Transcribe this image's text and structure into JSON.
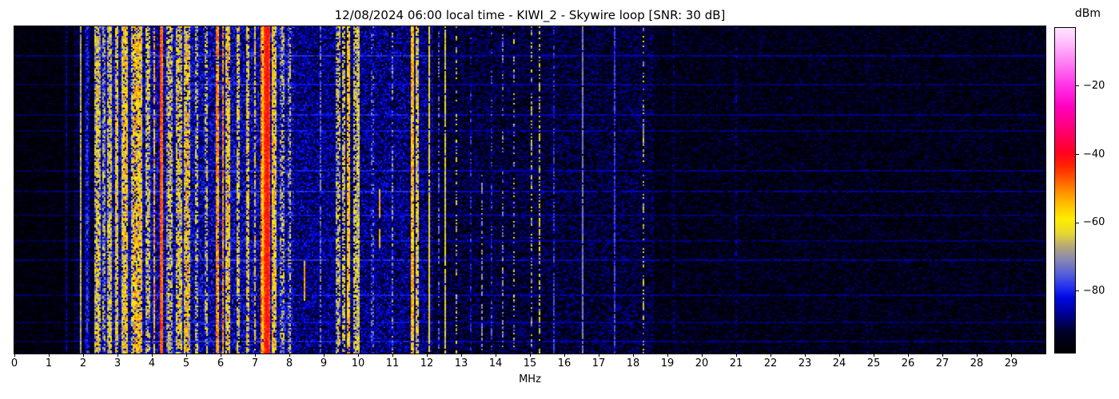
{
  "chart_data": {
    "type": "heatmap",
    "subtype": "radio-spectrum-waterfall",
    "title": "12/08/2024 06:00 local time - KIWI_2 - Skywire loop [SNR: 30 dB]",
    "xlabel": "MHz",
    "x_range": [
      0,
      30
    ],
    "x_ticks": [
      0,
      1,
      2,
      3,
      4,
      5,
      6,
      7,
      8,
      9,
      10,
      11,
      12,
      13,
      14,
      15,
      16,
      17,
      18,
      19,
      20,
      21,
      22,
      23,
      24,
      25,
      26,
      27,
      28,
      29
    ],
    "y_axis": "time (rows, no tick labels shown)",
    "grid": false,
    "legend": "none",
    "colorbar": {
      "label": "dBm",
      "position": "right",
      "ticks": [
        -20,
        -40,
        -60,
        -80
      ],
      "vmin": -98,
      "vmax": -3,
      "colormap": [
        [
          -98,
          "#000000"
        ],
        [
          -92,
          "#000028"
        ],
        [
          -87,
          "#000090"
        ],
        [
          -82,
          "#0008e0"
        ],
        [
          -79,
          "#2030f0"
        ],
        [
          -75,
          "#5560d8"
        ],
        [
          -71,
          "#8585b5"
        ],
        [
          -67,
          "#b5a878"
        ],
        [
          -63,
          "#e8d830"
        ],
        [
          -59,
          "#ffee00"
        ],
        [
          -55,
          "#ffc400"
        ],
        [
          -51,
          "#ff9000"
        ],
        [
          -47,
          "#ff5500"
        ],
        [
          -43,
          "#ff2000"
        ],
        [
          -39,
          "#ff0028"
        ],
        [
          -33,
          "#ff0070"
        ],
        [
          -26,
          "#ff00c0"
        ],
        [
          -20,
          "#ff30e8"
        ],
        [
          -13,
          "#ff80f4"
        ],
        [
          -7,
          "#ffc0fc"
        ],
        [
          -3,
          "#ffe2ff"
        ]
      ]
    },
    "noise_regions": [
      {
        "f0": 0.0,
        "f1": 1.7,
        "base": -96.5,
        "noise": 5.5
      },
      {
        "f0": 1.7,
        "f1": 2.32,
        "base": -93,
        "noise": 6
      },
      {
        "f0": 2.32,
        "f1": 8.15,
        "base": -85.5,
        "noise": 8.5
      },
      {
        "f0": 8.15,
        "f1": 12.2,
        "base": -88,
        "noise": 8
      },
      {
        "f0": 12.2,
        "f1": 18.6,
        "base": -92.5,
        "noise": 7
      },
      {
        "f0": 18.6,
        "f1": 30.01,
        "base": -95,
        "noise": 6
      }
    ],
    "row_streaks": [
      {
        "y": 0.09,
        "b": 7
      },
      {
        "y": 0.175,
        "b": 5
      },
      {
        "y": 0.27,
        "b": 6
      },
      {
        "y": 0.315,
        "b": 5
      },
      {
        "y": 0.44,
        "b": 6
      },
      {
        "y": 0.5,
        "b": 7
      },
      {
        "y": 0.575,
        "b": 5
      },
      {
        "y": 0.655,
        "b": 5
      },
      {
        "y": 0.71,
        "b": 7
      },
      {
        "y": 0.82,
        "b": 6
      },
      {
        "y": 0.9,
        "b": 5
      },
      {
        "y": 0.96,
        "b": 6
      }
    ],
    "signals": [
      {
        "f": 1.5,
        "w": 0.035,
        "level": -84,
        "var": 5,
        "duty": 0.85
      },
      {
        "f": 1.95,
        "w": 0.045,
        "level": -60,
        "var": 5,
        "duty": 0.95
      },
      {
        "f": 2.12,
        "w": 0.14,
        "level": -80,
        "var": 6,
        "duty": 0.9
      },
      {
        "f": 2.42,
        "w": 0.16,
        "level": -60,
        "var": 9,
        "duty": 0.8
      },
      {
        "f": 2.6,
        "w": 0.12,
        "level": -68,
        "var": 9,
        "duty": 0.7
      },
      {
        "f": 2.78,
        "w": 0.16,
        "level": -62,
        "var": 9,
        "duty": 0.8
      },
      {
        "f": 2.98,
        "w": 0.12,
        "level": -59,
        "var": 9,
        "duty": 0.8
      },
      {
        "f": 3.22,
        "w": 0.18,
        "level": -57,
        "var": 9,
        "duty": 0.85
      },
      {
        "f": 3.45,
        "w": 0.12,
        "level": -61,
        "var": 9,
        "duty": 0.75
      },
      {
        "f": 3.5,
        "w": 0.05,
        "level": -52,
        "var": 7,
        "duty": 0.8
      },
      {
        "f": 3.63,
        "w": 0.2,
        "level": -57,
        "var": 10,
        "duty": 0.85
      },
      {
        "f": 3.88,
        "w": 0.16,
        "level": -62,
        "var": 9,
        "duty": 0.7
      },
      {
        "f": 4.07,
        "w": 0.07,
        "level": -53,
        "var": 9,
        "duty": 0.85
      },
      {
        "f": 4.27,
        "w": 0.1,
        "level": -45,
        "var": 5,
        "duty": 1.0
      },
      {
        "f": 4.52,
        "w": 0.16,
        "level": -61,
        "var": 9,
        "duty": 0.7
      },
      {
        "f": 4.78,
        "w": 0.2,
        "level": -60,
        "var": 10,
        "duty": 0.75
      },
      {
        "f": 5.02,
        "w": 0.16,
        "level": -57,
        "var": 11,
        "duty": 0.8
      },
      {
        "f": 5.3,
        "w": 0.12,
        "level": -64,
        "var": 9,
        "duty": 0.6
      },
      {
        "f": 5.6,
        "w": 0.1,
        "level": -63,
        "var": 9,
        "duty": 0.6
      },
      {
        "f": 5.9,
        "w": 0.09,
        "level": -49,
        "var": 7,
        "duty": 0.95
      },
      {
        "f": 6.07,
        "w": 0.07,
        "level": -51,
        "var": 7,
        "duty": 0.9
      },
      {
        "f": 6.22,
        "w": 0.14,
        "level": -57,
        "var": 9,
        "duty": 0.8
      },
      {
        "f": 6.52,
        "w": 0.12,
        "level": -60,
        "var": 9,
        "duty": 0.7
      },
      {
        "f": 6.8,
        "w": 0.12,
        "level": -58,
        "var": 9,
        "duty": 0.75
      },
      {
        "f": 7.0,
        "w": 0.09,
        "level": -60,
        "var": 9,
        "duty": 0.7
      },
      {
        "f": 7.2,
        "w": 0.07,
        "level": -49,
        "var": 7,
        "duty": 0.95
      },
      {
        "f": 7.35,
        "w": 0.2,
        "level": -41,
        "var": 4,
        "duty": 1.0
      },
      {
        "f": 7.55,
        "w": 0.12,
        "level": -56,
        "var": 9,
        "duty": 0.85
      },
      {
        "f": 7.8,
        "w": 0.12,
        "level": -64,
        "var": 9,
        "duty": 0.6
      },
      {
        "f": 8.02,
        "w": 0.09,
        "level": -63,
        "var": 9,
        "duty": 0.55
      },
      {
        "f": 8.44,
        "w": 0.05,
        "level": -53,
        "var": 5,
        "duty": 0.9,
        "y0": 0.71,
        "y1": 0.84
      },
      {
        "f": 8.9,
        "w": 0.035,
        "level": -73,
        "var": 6,
        "duty": 0.7
      },
      {
        "f": 9.42,
        "w": 0.12,
        "level": -62,
        "var": 9,
        "duty": 0.65
      },
      {
        "f": 9.58,
        "w": 0.09,
        "level": -61,
        "var": 9,
        "duty": 0.65
      },
      {
        "f": 9.72,
        "w": 0.06,
        "level": -51,
        "var": 7,
        "duty": 0.85
      },
      {
        "f": 9.9,
        "w": 0.09,
        "level": -61,
        "var": 9,
        "duty": 0.65
      },
      {
        "f": 10.0,
        "w": 0.055,
        "level": -59,
        "var": 7,
        "duty": 0.9
      },
      {
        "f": 10.42,
        "w": 0.05,
        "level": -70,
        "var": 9,
        "duty": 0.5
      },
      {
        "f": 10.63,
        "w": 0.045,
        "level": -54,
        "var": 3,
        "duty": 1.0,
        "y0": 0.5,
        "y1": 0.585
      },
      {
        "f": 10.63,
        "w": 0.045,
        "level": -54,
        "var": 3,
        "duty": 1.0,
        "y0": 0.62,
        "y1": 0.68
      },
      {
        "f": 11.0,
        "w": 0.05,
        "level": -72,
        "var": 9,
        "duty": 0.5
      },
      {
        "f": 11.58,
        "w": 0.1,
        "level": -54,
        "var": 8,
        "duty": 0.95
      },
      {
        "f": 11.72,
        "w": 0.1,
        "level": -60,
        "var": 9,
        "duty": 0.8
      },
      {
        "f": 12.07,
        "w": 0.04,
        "level": -59,
        "var": 5,
        "duty": 0.95
      },
      {
        "f": 12.35,
        "w": 0.05,
        "level": -76,
        "var": 7,
        "duty": 0.6
      },
      {
        "f": 12.55,
        "w": 0.035,
        "level": -60,
        "var": 4,
        "duty": 0.95
      },
      {
        "f": 12.85,
        "w": 0.05,
        "level": -64,
        "var": 9,
        "duty": 0.4
      },
      {
        "f": 13.3,
        "w": 0.04,
        "level": -75,
        "var": 7,
        "duty": 0.6
      },
      {
        "f": 13.6,
        "w": 0.035,
        "level": -70,
        "var": 4,
        "duty": 0.6,
        "y0": 0.45,
        "y1": 1.0
      },
      {
        "f": 13.9,
        "w": 0.04,
        "level": -75,
        "var": 7,
        "duty": 0.5
      },
      {
        "f": 14.2,
        "w": 0.04,
        "level": -71,
        "var": 7,
        "duty": 0.45
      },
      {
        "f": 14.55,
        "w": 0.045,
        "level": -64,
        "var": 9,
        "duty": 0.4
      },
      {
        "f": 15.05,
        "w": 0.05,
        "level": -68,
        "var": 9,
        "duty": 0.5
      },
      {
        "f": 15.27,
        "w": 0.06,
        "level": -63,
        "var": 9,
        "duty": 0.6
      },
      {
        "f": 15.7,
        "w": 0.03,
        "level": -79,
        "var": 5,
        "duty": 0.7
      },
      {
        "f": 16.53,
        "w": 0.035,
        "level": -71,
        "var": 3,
        "duty": 0.95
      },
      {
        "f": 17.47,
        "w": 0.03,
        "level": -77,
        "var": 4,
        "duty": 0.9
      },
      {
        "f": 18.3,
        "w": 0.035,
        "level": -67,
        "var": 7,
        "duty": 0.45
      },
      {
        "f": 19.2,
        "w": 0.025,
        "level": -84,
        "var": 5,
        "duty": 0.5
      },
      {
        "f": 21.0,
        "w": 0.025,
        "level": -87,
        "var": 5,
        "duty": 0.45
      },
      {
        "f": 24.8,
        "w": 0.025,
        "level": -88,
        "var": 5,
        "duty": 0.5
      }
    ],
    "seed": 11,
    "cell": 2
  }
}
